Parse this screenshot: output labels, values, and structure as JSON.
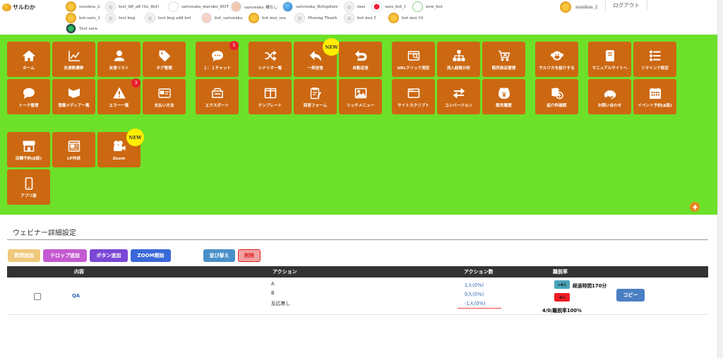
{
  "topbar": {
    "logo_text": "サルわか",
    "accounts": [
      {
        "name": "susukoa_2",
        "avatar": "sun-avatar"
      },
      {
        "name": "test_liff_aff (Su_Bot)",
        "avatar": "camera-avatar"
      },
      {
        "name": "saruwaka_maruko_BOT",
        "avatar": "girl-avatar"
      },
      {
        "name": "saruwaka_構なし",
        "avatar": "face-avatar"
      },
      {
        "name": "saruwaka_Botupdate",
        "avatar": "globe-avatar"
      },
      {
        "name": "loas",
        "avatar": "camera-avatar"
      },
      {
        "name": "sara_bot_1",
        "avatar": "red-avatar"
      },
      {
        "name": "new_bot",
        "avatar": "ring-avatar"
      },
      {
        "name": "bot-saru_2",
        "avatar": "sun-avatar"
      },
      {
        "name": "test bug",
        "avatar": "camera-avatar"
      },
      {
        "name": "test bug add bot",
        "avatar": "camera-avatar"
      },
      {
        "name": "bot_saruwaka",
        "avatar": "pig-avatar"
      },
      {
        "name": "bot moi_sea",
        "avatar": "sun-avatar"
      },
      {
        "name": "Phuong Thanh",
        "avatar": "camera-avatar"
      },
      {
        "name": "bot moi 5",
        "avatar": "camera-avatar"
      },
      {
        "name": "bot moi 10",
        "avatar": "sun-avatar"
      },
      {
        "name": "Test saru",
        "avatar": "dark-avatar"
      }
    ],
    "current_user": "susukoa_2",
    "logout": "ログアウト"
  },
  "menu": [
    {
      "label": "ホーム",
      "icon": "home-icon"
    },
    {
      "label": "友達数遷移",
      "icon": "chart-icon"
    },
    {
      "label": "友達リスト",
      "icon": "user-icon"
    },
    {
      "label": "タグ管理",
      "icon": "tag-icon"
    },
    {
      "label": "１：１チャット",
      "icon": "chat-icon",
      "badge": "5"
    },
    {
      "label": "シナリオ一覧",
      "icon": "shuffle-icon"
    },
    {
      "label": "一斉送信",
      "icon": "reply-icon",
      "new": "NEW"
    },
    {
      "label": "自動返信",
      "icon": "return-icon"
    },
    {
      "label": "URLクリック測定",
      "icon": "url-click-icon"
    },
    {
      "label": "流入経路分析",
      "icon": "sitemap-icon"
    },
    {
      "label": "販売商品管理",
      "icon": "cart-icon"
    },
    {
      "label": "サルワカを紹介する",
      "icon": "monkey-icon"
    },
    {
      "label": "マニュアルサイトへ",
      "icon": "book-icon"
    },
    {
      "label": "リマインド設定",
      "icon": "list-icon"
    },
    {
      "label": "トーク管理",
      "icon": "talk-icon"
    },
    {
      "label": "登録メディア一覧",
      "icon": "media-icon"
    },
    {
      "label": "エラー一覧",
      "icon": "warning-icon",
      "badge": "3"
    },
    {
      "label": "支払い方法",
      "icon": "card-icon"
    },
    {
      "label": "エクスポート",
      "icon": "export-icon"
    },
    {
      "label": "テンプレート",
      "icon": "columns-icon"
    },
    {
      "label": "回答フォーム",
      "icon": "form-icon"
    },
    {
      "label": "リッチメニュー",
      "icon": "image-icon"
    },
    {
      "label": "サイトスクリプト",
      "icon": "script-icon"
    },
    {
      "label": "コンバージョン",
      "icon": "exchange-icon"
    },
    {
      "label": "販売履歴",
      "icon": "yen-icon"
    },
    {
      "label": "紹介料確認",
      "icon": "coins-icon"
    },
    {
      "label": "お問い合わせ",
      "icon": "support-icon"
    },
    {
      "label": "イベント予約(β版)",
      "icon": "calendar-icon"
    },
    {
      "label": "店舗予約(β版)",
      "icon": "store-icon"
    },
    {
      "label": "LP作成",
      "icon": "lp-icon"
    },
    {
      "label": "Zoom",
      "icon": "video-icon",
      "new": "NEW"
    },
    {
      "label": "アプリ版",
      "icon": "mobile-icon"
    }
  ],
  "page": {
    "title": "ウェビナー詳細設定",
    "buttons": {
      "question": "質問追加",
      "telop": "テロップ追加",
      "button_add": "ボタン追加",
      "zoom_start": "ZOOM開始",
      "sort": "並び替え",
      "delete": "削除"
    },
    "table": {
      "headers": {
        "content": "内容",
        "action": "アクション",
        "action_count": "アクション数",
        "churn": "離脱率"
      },
      "rows": [
        {
          "content": "QA",
          "actions": [
            "A",
            "B",
            "反応無し"
          ],
          "counts": [
            "1人(0%)",
            "0人(0%)",
            "-1人(0%)"
          ],
          "plus_tag": "+4人",
          "minus_tag": "-4人",
          "elapsed": "経過時間170分",
          "churn_text": "4/0/離脱率100%",
          "copy": "コピー"
        }
      ]
    }
  },
  "colors": {
    "green_bg": "#6de02a",
    "tile": "#cc6812",
    "badge": "#e8202a",
    "new_badge": "#ffee00"
  }
}
